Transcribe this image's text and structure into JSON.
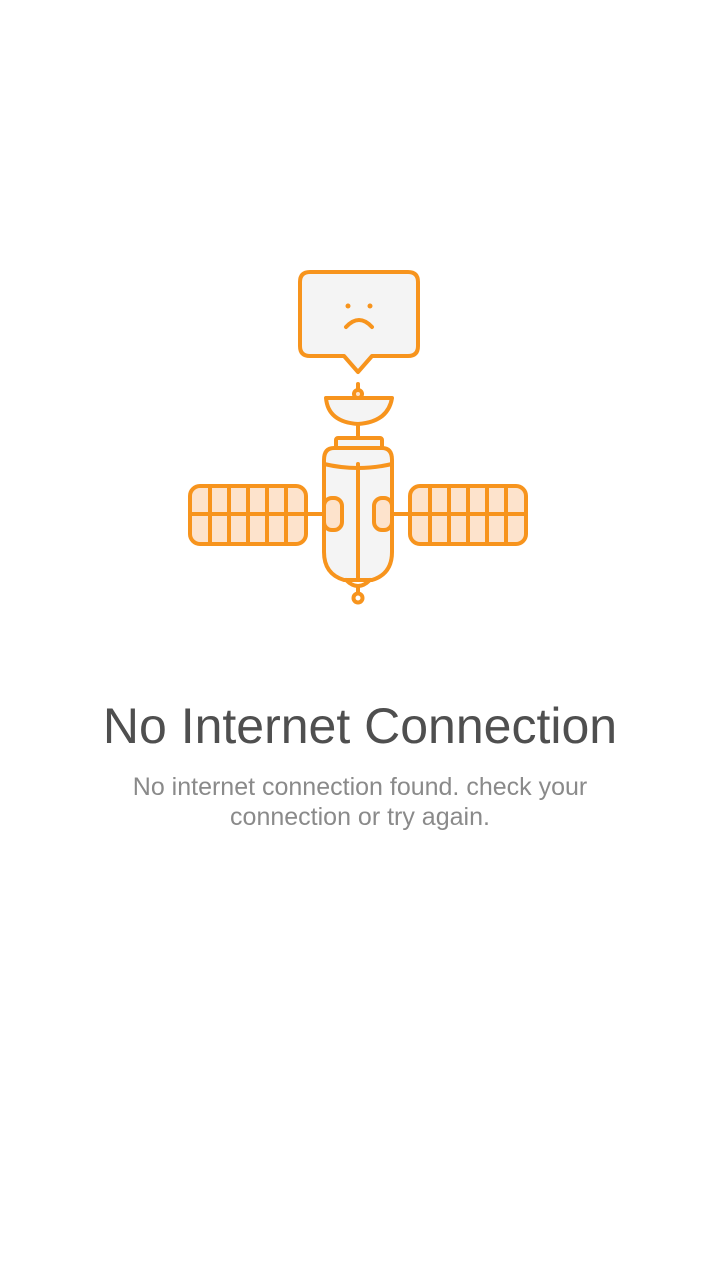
{
  "empty_state": {
    "illustration_icon": "satellite-sad-speech-bubble-icon",
    "title": "No Internet Connection",
    "message": "No internet connection found. check your connection or try again."
  },
  "colors": {
    "accent": "#F7941D",
    "accent_fill": "#FDE3CC",
    "body_fill": "#F4F4F4",
    "title_text": "#4F4F4F",
    "message_text": "#8A8A8A",
    "background": "#FFFFFF"
  }
}
